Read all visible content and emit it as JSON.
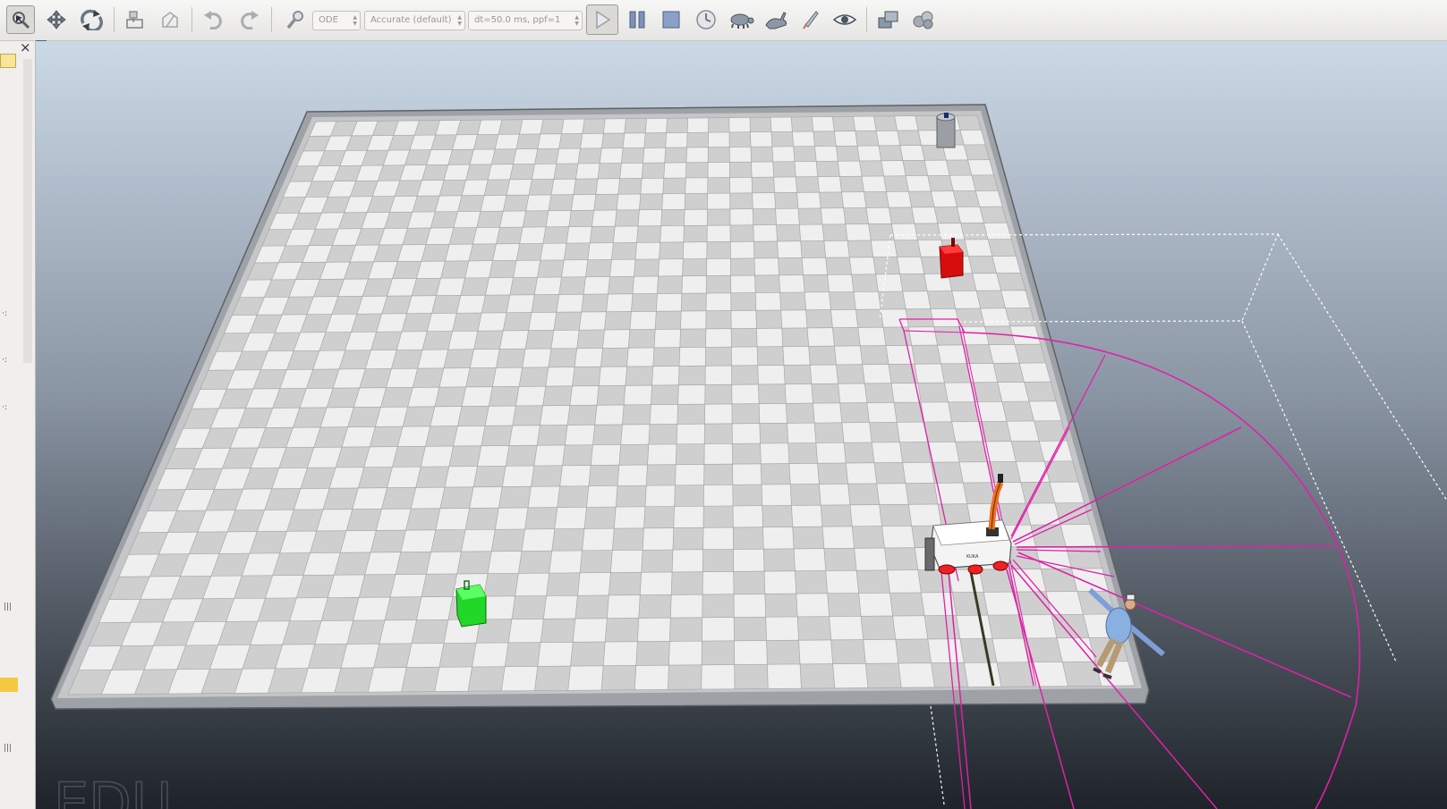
{
  "toolbar": {
    "physics_engine": "ODE",
    "integrator": "Accurate (default)",
    "timestep": "dt=50.0 ms, ppf=1",
    "buttons": [
      {
        "name": "select-tool",
        "icon": "magnifier-arrow-icon"
      },
      {
        "name": "translate-tool",
        "icon": "move-arrows-icon"
      },
      {
        "name": "rotate-tool",
        "icon": "rotate-icon"
      },
      {
        "name": "object-position",
        "icon": "object-position-icon"
      },
      {
        "name": "object-orientation",
        "icon": "object-orientation-icon"
      },
      {
        "name": "undo",
        "icon": "undo-icon"
      },
      {
        "name": "redo",
        "icon": "redo-icon"
      },
      {
        "name": "calculation-module",
        "icon": "wrench-icon"
      },
      {
        "name": "start-simulation",
        "icon": "play-icon"
      },
      {
        "name": "pause-simulation",
        "icon": "pause-icon"
      },
      {
        "name": "stop-simulation",
        "icon": "stop-icon"
      },
      {
        "name": "real-time",
        "icon": "clock-icon"
      },
      {
        "name": "slow-down",
        "icon": "turtle-icon"
      },
      {
        "name": "speed-up",
        "icon": "rabbit-icon"
      },
      {
        "name": "threaded-rendering",
        "icon": "rocket-icon"
      },
      {
        "name": "toggle-visualization",
        "icon": "eye-icon"
      },
      {
        "name": "page-selector",
        "icon": "pages-icon"
      },
      {
        "name": "scene-selector",
        "icon": "scenes-icon"
      }
    ]
  },
  "panel": {
    "close_glyph": "×",
    "float_glyph": "▫"
  },
  "viewport": {
    "watermark": "EDU",
    "robot_label": "KUKA"
  },
  "colors": {
    "sky_top": "#c9d6e4",
    "sky_bottom": "#1e2329",
    "floor_light": "#efefef",
    "floor_dark": "#cfcfcf",
    "sensor_magenta": "#e020a8",
    "green_box": "#22e02a",
    "red_box": "#e01010",
    "robot_arm": "#f07020"
  }
}
